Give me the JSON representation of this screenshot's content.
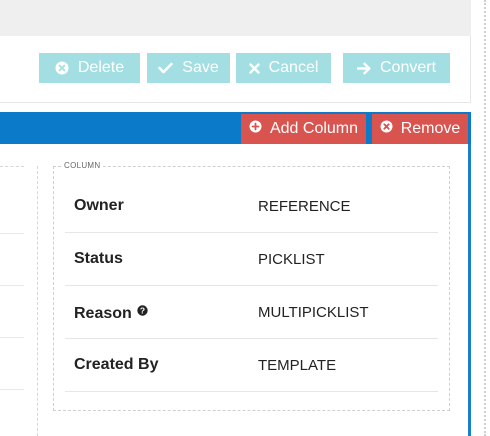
{
  "toolbar": {
    "delete_label": "Delete",
    "save_label": "Save",
    "cancel_label": "Cancel",
    "convert_label": "Convert",
    "button_color": "#a3dfe2"
  },
  "header": {
    "add_column_label": "Add Column",
    "remove_label": "Remove",
    "bar_color": "#0b7ac9",
    "danger_color": "#d9534f"
  },
  "column": {
    "legend": "COLUMN",
    "rows": [
      {
        "label": "Owner",
        "value": "REFERENCE"
      },
      {
        "label": "Status",
        "value": "PICKLIST"
      },
      {
        "label": "Reason",
        "value": "MULTIPICKLIST",
        "help": true
      },
      {
        "label": "Created By",
        "value": "TEMPLATE"
      }
    ]
  }
}
